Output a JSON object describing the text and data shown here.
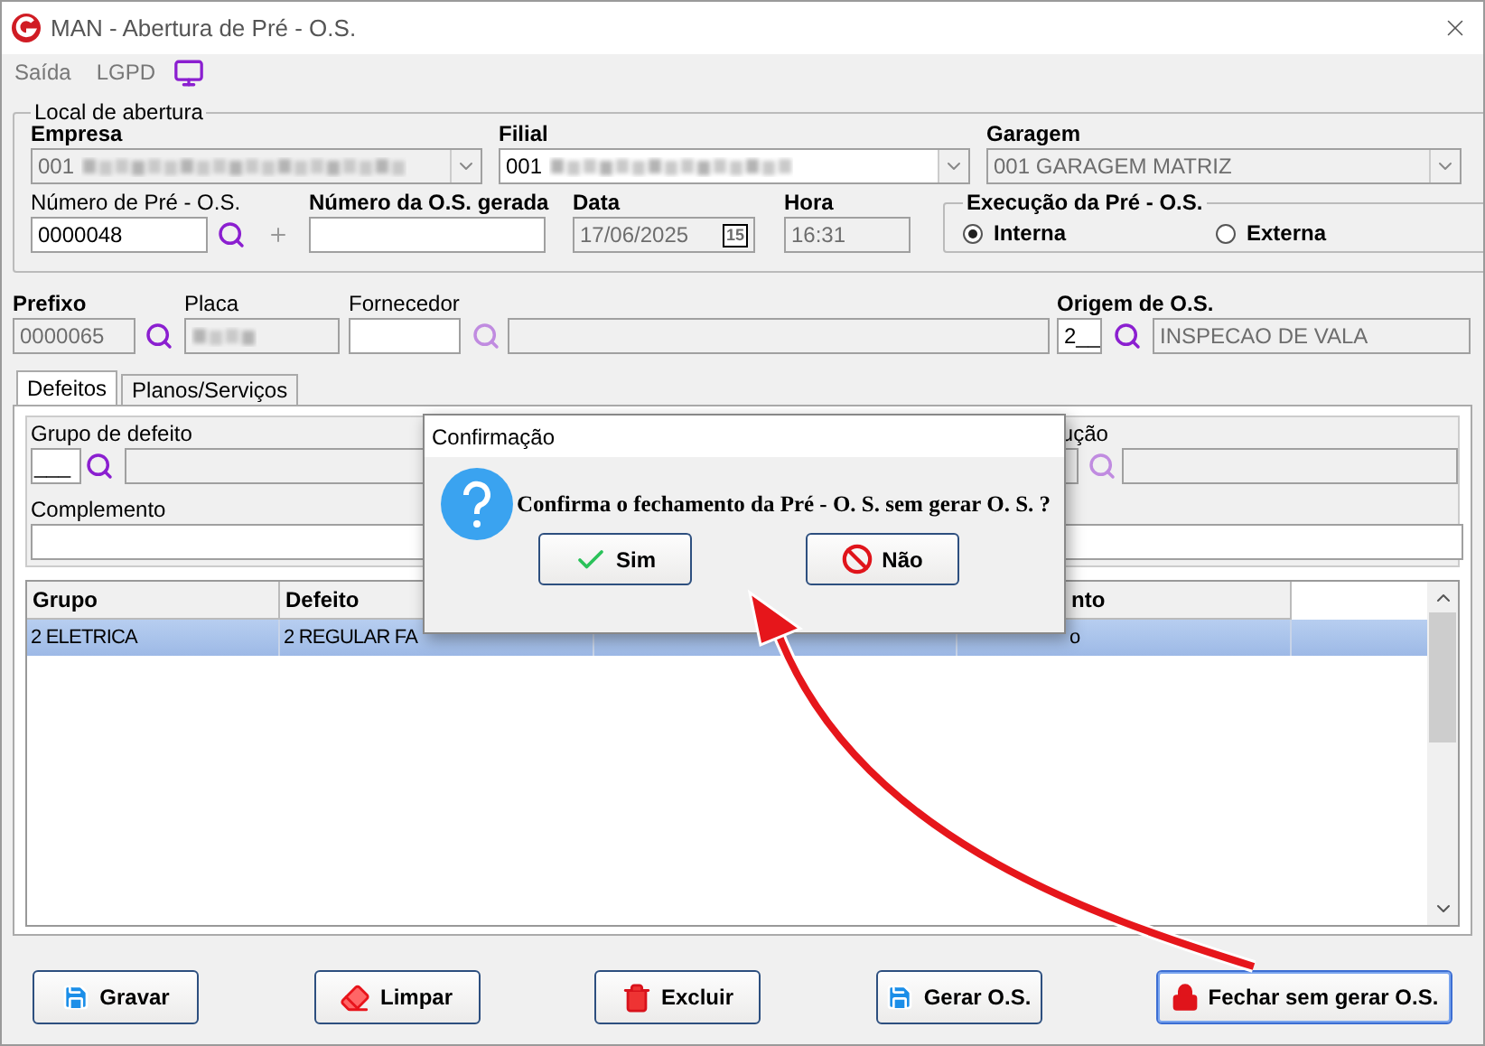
{
  "window": {
    "title": "MAN - Abertura de Pré - O.S."
  },
  "menu": [
    "Saída",
    "LGPD"
  ],
  "local": {
    "legend": "Local de abertura",
    "empresa": {
      "label": "Empresa",
      "value": "001"
    },
    "filial": {
      "label": "Filial",
      "value": "001"
    },
    "garagem": {
      "label": "Garagem",
      "value": "001 GARAGEM MATRIZ"
    },
    "numero_pre": {
      "label": "Número de Pré - O.S.",
      "value": "0000048"
    },
    "numero_os": {
      "label": "Número da O.S. gerada"
    },
    "data": {
      "label": "Data",
      "value": "17/06/2025",
      "calendar": "15"
    },
    "hora": {
      "label": "Hora",
      "value": "16:31"
    },
    "execucao": {
      "legend": "Execução da Pré - O.S.",
      "options": [
        {
          "label": "Interna",
          "selected": true
        },
        {
          "label": "Externa",
          "selected": false
        }
      ]
    }
  },
  "prefixo": {
    "label": "Prefixo",
    "value": "0000065"
  },
  "placa": {
    "label": "Placa"
  },
  "fornecedor": {
    "label": "Fornecedor"
  },
  "origem": {
    "label": "Origem de O.S.",
    "code": "2__",
    "value": "INSPECAO DE VALA"
  },
  "tabs": [
    {
      "label": "Defeitos",
      "selected": true
    },
    {
      "label": "Planos/Serviços",
      "selected": false
    }
  ],
  "defeitos": {
    "grupo_label": "Grupo de defeito",
    "grupo_code": "___",
    "right_label": "ução",
    "complemento_label": "Complemento",
    "columns": [
      "Grupo",
      "Defeito",
      "nto"
    ],
    "rows": [
      {
        "cells": [
          "2 ELETRICA",
          "2 REGULAR FA",
          "o"
        ],
        "selected": true
      }
    ]
  },
  "buttons": [
    {
      "label": "Gravar",
      "kind": "save",
      "focused": false
    },
    {
      "label": "Limpar",
      "kind": "eraser",
      "focused": false
    },
    {
      "label": "Excluir",
      "kind": "trash",
      "focused": false
    },
    {
      "label": "Gerar O.S.",
      "kind": "save",
      "focused": false
    },
    {
      "label": "Fechar sem gerar O.S.",
      "kind": "lock",
      "focused": true
    }
  ],
  "dialog": {
    "title": "Confirmação",
    "message": "Confirma o fechamento da Pré - O. S. sem gerar O. S. ?",
    "buttons": [
      {
        "label": "Sim",
        "kind": "check"
      },
      {
        "label": "Não",
        "kind": "no"
      }
    ]
  }
}
